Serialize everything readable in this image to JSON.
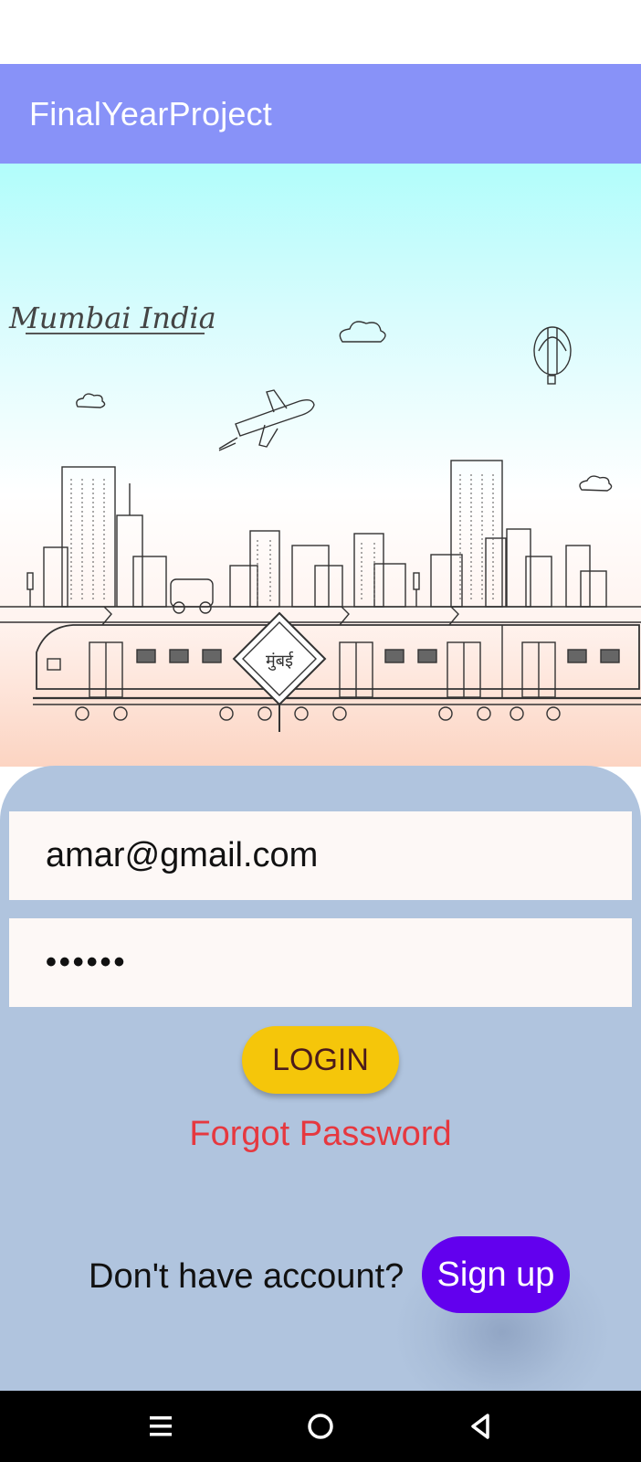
{
  "app": {
    "title": "FinalYearProject",
    "accent": "#8892f8"
  },
  "hero": {
    "script_text": "Mumbai India",
    "station_sign": "मुंबई"
  },
  "form": {
    "email_value": "amar@gmail.com",
    "password_value": "••••••",
    "login_label": "LOGIN",
    "forgot_label": "Forgot Password",
    "no_account_text": "Don't have account?",
    "signup_label": "Sign up",
    "colors": {
      "card": "#b0c4de",
      "login": "#f5c60a",
      "signup": "#6200ee",
      "forgot": "#e6383f"
    }
  },
  "navbar": {
    "icons": [
      "menu-icon",
      "home-circle-icon",
      "back-triangle-icon"
    ]
  }
}
